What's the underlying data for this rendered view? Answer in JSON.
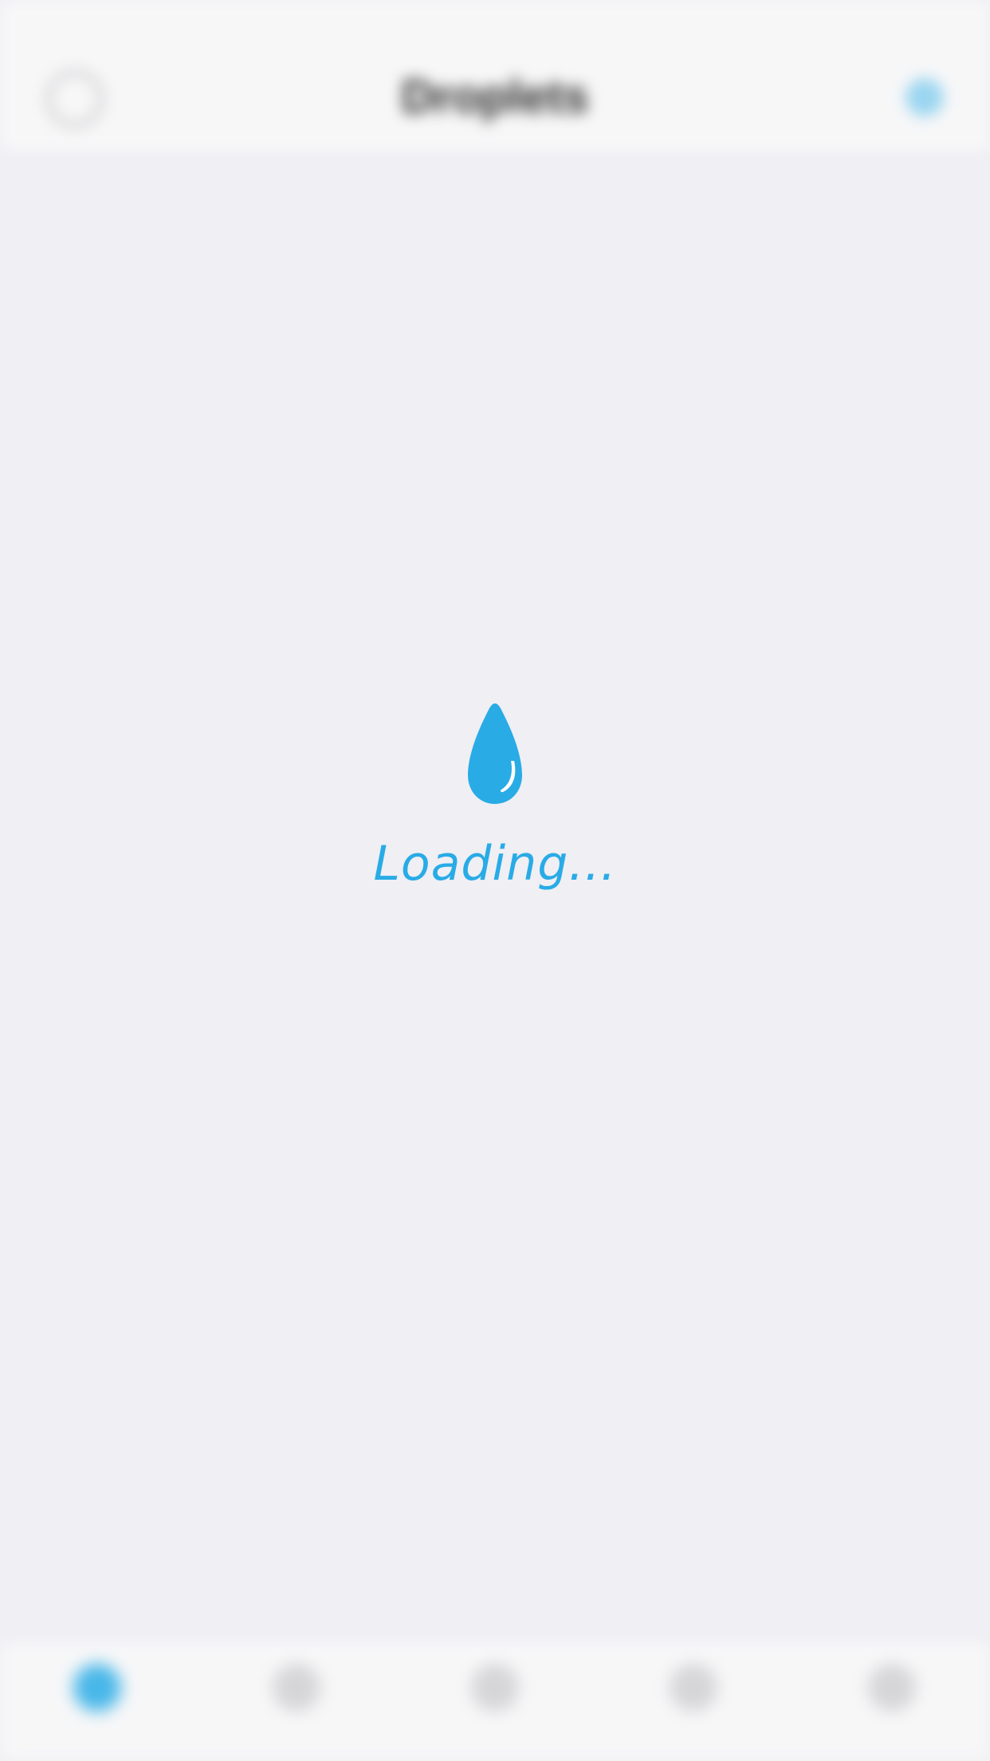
{
  "header": {
    "title": "Droplets"
  },
  "loading": {
    "text": "Loading...",
    "accent_color": "#29abe6",
    "icon": "water-drop-icon"
  },
  "tabbar": {
    "active_index": 0,
    "items": [
      {
        "icon": "droplet-icon"
      },
      {
        "icon": "tab-icon"
      },
      {
        "icon": "tab-icon"
      },
      {
        "icon": "tab-icon"
      },
      {
        "icon": "tab-icon"
      }
    ]
  }
}
